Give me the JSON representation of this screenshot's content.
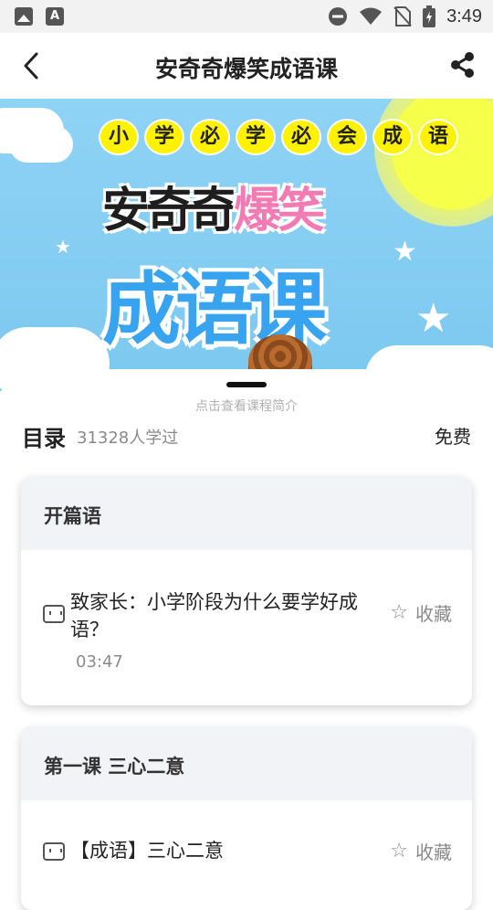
{
  "status_bar": {
    "time": "3:49",
    "icons": [
      "image-icon",
      "font-a-icon",
      "dnd-icon",
      "wifi-icon",
      "no-sim-icon",
      "battery-charging-icon"
    ]
  },
  "nav": {
    "title": "安奇奇爆笑成语课",
    "back_icon": "chevron-left-icon",
    "share_icon": "share-icon"
  },
  "banner": {
    "top_chars": [
      "小",
      "学",
      "必",
      "学",
      "必",
      "会",
      "成",
      "语"
    ],
    "line1_dark": "安奇奇",
    "line1_pink": "爆笑",
    "line2": "成语课"
  },
  "sheet": {
    "hint": "点击查看课程简介",
    "toc_title": "目录",
    "learned_count": "31328人学过",
    "price": "免费"
  },
  "sections": [
    {
      "title": "开篇语",
      "lessons": [
        {
          "title": "致家长：小学阶段为什么要学好成语？",
          "duration": "03:47",
          "fav_label": "收藏"
        }
      ]
    },
    {
      "title": "第一课 三心二意",
      "lessons": [
        {
          "title": "【成语】三心二意",
          "duration": "",
          "fav_label": "收藏"
        }
      ]
    }
  ],
  "colors": {
    "banner_sky": "#8fd3f5",
    "sun": "#f6ff4a",
    "title_blue": "#38a3ef",
    "title_pink": "#f27bb4"
  }
}
